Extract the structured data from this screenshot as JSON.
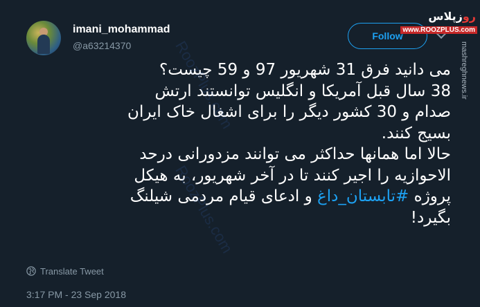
{
  "profile": {
    "display_name": "imani_mohammad",
    "handle": "@a63214370",
    "avatar_icon": "profile-photo"
  },
  "follow_button": {
    "label": "Follow"
  },
  "tweet": {
    "lines": [
      "می دانید فرق 31 شهریور 97 و 59 چیست؟",
      "38 سال قبل آمریکا و انگلیس توانستند ارتش",
      "صدام و 30 کشور دیگر را برای اشغال خاک ایران",
      "بسیج کنند.",
      "حالا اما همانها حداکثر می توانند مزدورانی درحد",
      "الاحوازیه را اجیر کنند تا در آخر شهریور، به هیکل"
    ],
    "line7_prefix": "پروژه ",
    "hashtag": "#تابستان_داغ",
    "line7_suffix": " و ادعای قیام مردمی شیلنگ",
    "line8": "بگیرد!"
  },
  "translate": {
    "label": "Translate Tweet",
    "icon": "globe-icon"
  },
  "timestamp": "3:17 PM - 23 Sep 2018",
  "watermark": {
    "logo_a": "رو",
    "logo_b": "زپلاس",
    "site": "www.ROOZPLUS.com",
    "side_text": "mashreghnews.ir",
    "diag_text": "RoozPlus.com"
  },
  "colors": {
    "background": "#15202b",
    "text": "#ffffff",
    "muted": "#8899a6",
    "accent": "#1da1f2"
  }
}
